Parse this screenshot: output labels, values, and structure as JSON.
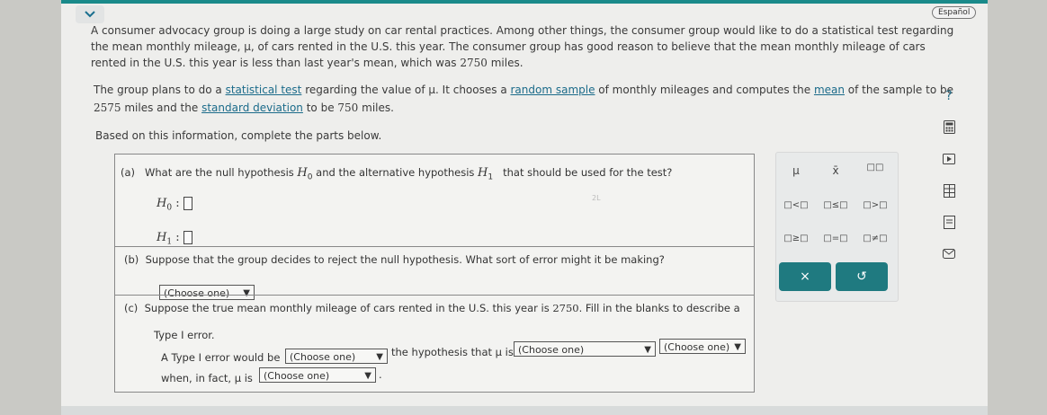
{
  "header": {
    "language_button": "Español"
  },
  "problem": {
    "intro_p1": "A consumer advocacy group is doing a large study on car rental practices. Among other things, the consumer group would like to do a statistical test regarding",
    "intro_p2": "the mean monthly mileage, μ, of cars rented in the U.S. this year. The consumer group has good reason to believe that the mean monthly mileage of cars",
    "intro_p3_a": "rented in the U.S. this year is less than last year's mean, which was ",
    "intro_p3_b": "2750",
    "intro_p3_c": " miles.",
    "plan_a": "The group plans to do a ",
    "plan_link_test": "statistical test",
    "plan_b": " regarding the value of μ. It chooses a ",
    "plan_link_sample": "random sample",
    "plan_c": " of monthly mileages and computes the ",
    "plan_link_mean": "mean",
    "plan_d": " of the sample to be",
    "plan_e": "2575",
    "plan_f": " miles and the ",
    "plan_link_sd": "standard deviation",
    "plan_g": " to be ",
    "plan_h": "750",
    "plan_i": " miles.",
    "based_on": "Based on this information, complete the parts below."
  },
  "part_a": {
    "label": "(a)",
    "q1": "What are the null hypothesis ",
    "h0_sym": "H",
    "h0_sub": "0",
    "q2": " and the alternative hypothesis ",
    "h1_sym": "H",
    "h1_sub": "1",
    "q3": " that should be used for the test?",
    "colon": ":",
    "faint_mark": "2L"
  },
  "part_b": {
    "label": "(b)",
    "question": "Suppose that the group decides to reject the null hypothesis. What sort of error might it be making?",
    "select": "(Choose one)"
  },
  "part_c": {
    "label": "(c)",
    "q1_a": "Suppose the true mean monthly mileage of cars rented in the U.S. this year is ",
    "q1_b": "2750",
    "q1_c": ". Fill in the blanks to describe a",
    "q2": "Type I error.",
    "s1": "A Type I error would be",
    "select1": "(Choose one)",
    "s2": "the hypothesis that μ is",
    "select2": "(Choose one)",
    "select3": "(Choose one)",
    "s3": "when, in fact, μ is",
    "select4": "(Choose one)",
    "period": "."
  },
  "palette": {
    "mu": "μ",
    "xbar": "x̄",
    "superscript": "□□",
    "lt": "□<□",
    "le": "□≤□",
    "gt": "□>□",
    "ge": "□≥□",
    "eq": "□=□",
    "ne": "□≠□",
    "clear": "×",
    "undo": "↺"
  },
  "sidebar": {
    "help": "?"
  },
  "arrow_glyph": "▼"
}
